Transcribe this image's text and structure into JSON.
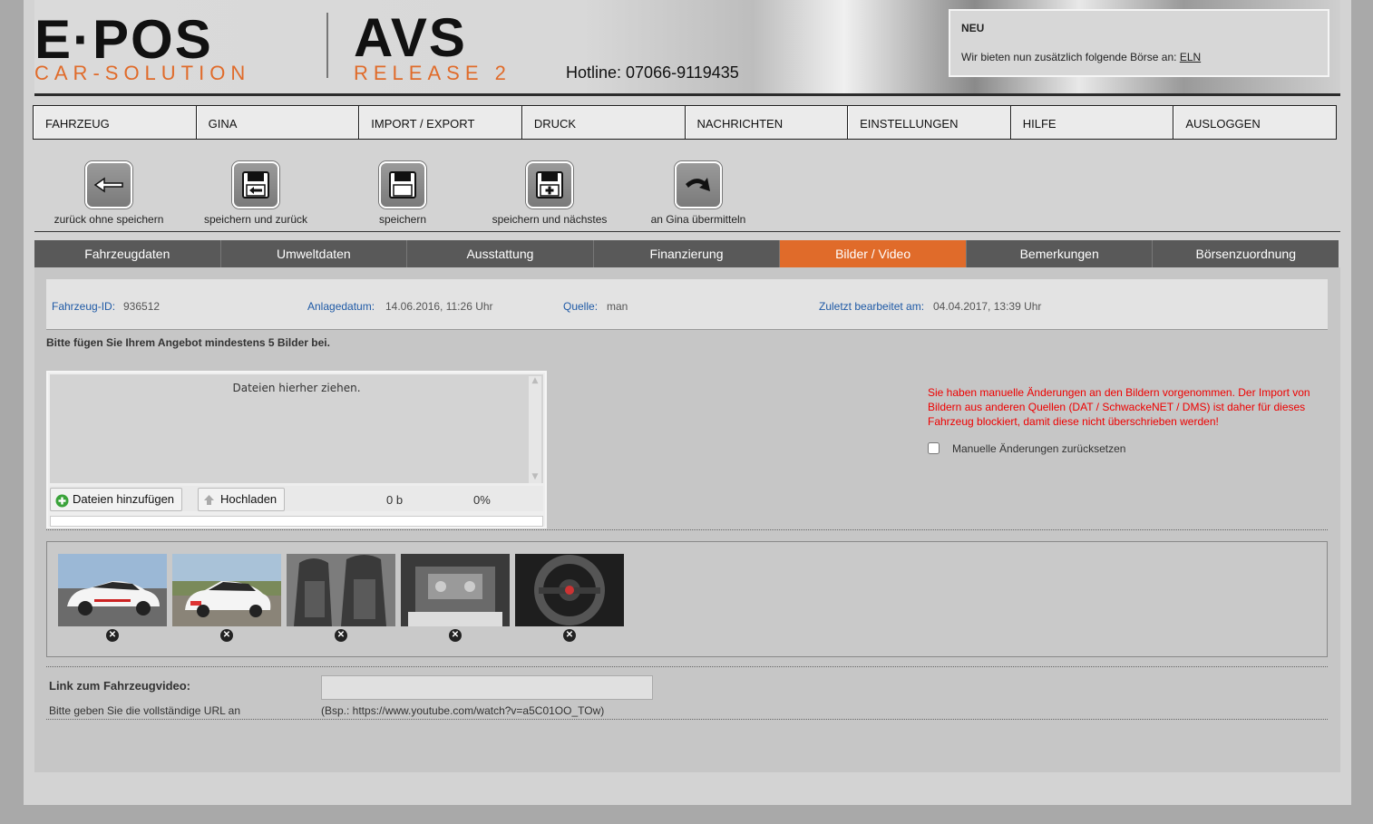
{
  "header": {
    "logo_top": "E·POS",
    "logo_sub": "CAR-SOLUTION",
    "avs_top": "AVS",
    "avs_sub": "RELEASE 2",
    "hotline": "Hotline: 07066-9119435",
    "news_title": "NEU",
    "news_text": "Wir bieten nun zusätzlich folgende Börse an:",
    "news_link": "ELN"
  },
  "nav": [
    "FAHRZEUG",
    "GINA",
    "IMPORT / EXPORT",
    "DRUCK",
    "NACHRICHTEN",
    "EINSTELLUNGEN",
    "HILFE",
    "AUSLOGGEN"
  ],
  "toolbar": {
    "back": "zurück ohne speichern",
    "save_back": "speichern und zurück",
    "save": "speichern",
    "save_next": "speichern und nächstes",
    "send_gina": "an Gina übermitteln"
  },
  "tabs": [
    "Fahrzeugdaten",
    "Umweltdaten",
    "Ausstattung",
    "Finanzierung",
    "Bilder / Video",
    "Bemerkungen",
    "Börsenzuordnung"
  ],
  "active_tab": "Bilder / Video",
  "info": {
    "id_label": "Fahrzeug-ID:",
    "id_value": "936512",
    "created_label": "Anlagedatum:",
    "created_value": "14.06.2016, 11:26 Uhr",
    "source_label": "Quelle:",
    "source_value": "man",
    "edited_label": "Zuletzt bearbeitet am:",
    "edited_value": "04.04.2017, 13:39 Uhr"
  },
  "hint": "Bitte fügen Sie Ihrem Angebot mindestens 5 Bilder bei.",
  "uploader": {
    "dropzone": "Dateien hierher ziehen.",
    "add_files": "Dateien hinzufügen",
    "upload": "Hochladen",
    "size": "0 b",
    "percent": "0%",
    "progress": 0
  },
  "notice": "Sie haben manuelle Änderungen an den Bildern vorgenommen. Der Import von Bildern aus anderen Quellen (DAT / SchwackeNET / DMS) ist daher für dieses Fahrzeug blockiert, damit diese nicht überschrieben werden!",
  "reset_label": "Manuelle Änderungen zurücksetzen",
  "video": {
    "label": "Link zum Fahrzeugvideo:",
    "help": "Bitte geben Sie die vollständige URL an",
    "example": "(Bsp.: https://www.youtube.com/watch?v=a5C01OO_TOw)",
    "value": ""
  },
  "colors": {
    "accent": "#e06b2a",
    "link": "#1f5aa6",
    "warning": "#ee0000"
  }
}
